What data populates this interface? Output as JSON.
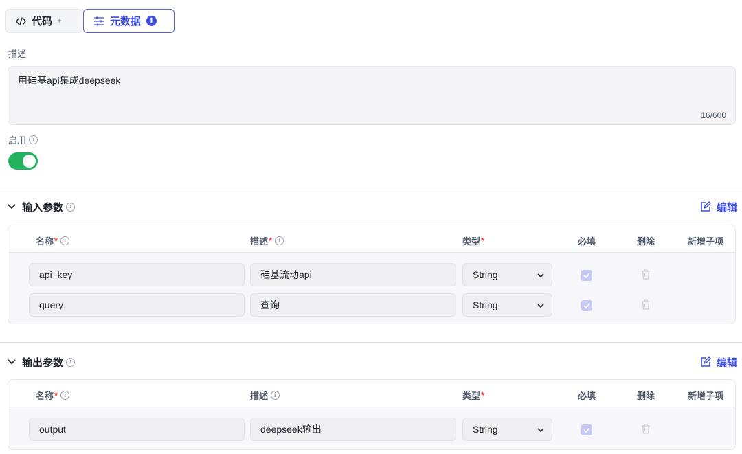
{
  "tabs": {
    "code_label": "代码",
    "meta_label": "元数据",
    "meta_info": "i"
  },
  "description": {
    "label": "描述",
    "value": "用硅基api集成deepseek",
    "count": "16/600"
  },
  "enable": {
    "label": "启用",
    "info": "i",
    "on": true
  },
  "input_params": {
    "title": "输入参数",
    "edit_label": "编辑",
    "headers": {
      "name": "名称",
      "desc": "描述",
      "type": "类型",
      "required": "必填",
      "delete": "删除",
      "add_child": "新增子项",
      "star": "*"
    },
    "rows": [
      {
        "name": "api_key",
        "desc": "硅基流动api",
        "type": "String",
        "required": true
      },
      {
        "name": "query",
        "desc": "查询",
        "type": "String",
        "required": true
      }
    ]
  },
  "output_params": {
    "title": "输出参数",
    "edit_label": "编辑",
    "headers": {
      "name": "名称",
      "desc": "描述",
      "type": "类型",
      "required": "必填",
      "delete": "删除",
      "add_child": "新增子项",
      "star": "*"
    },
    "rows": [
      {
        "name": "output",
        "desc": "deepseek输出",
        "type": "String",
        "required": true
      }
    ]
  },
  "colors": {
    "accent": "#3f4ee0",
    "toggle_on": "#22b35e",
    "required_star": "#f53f3f"
  }
}
